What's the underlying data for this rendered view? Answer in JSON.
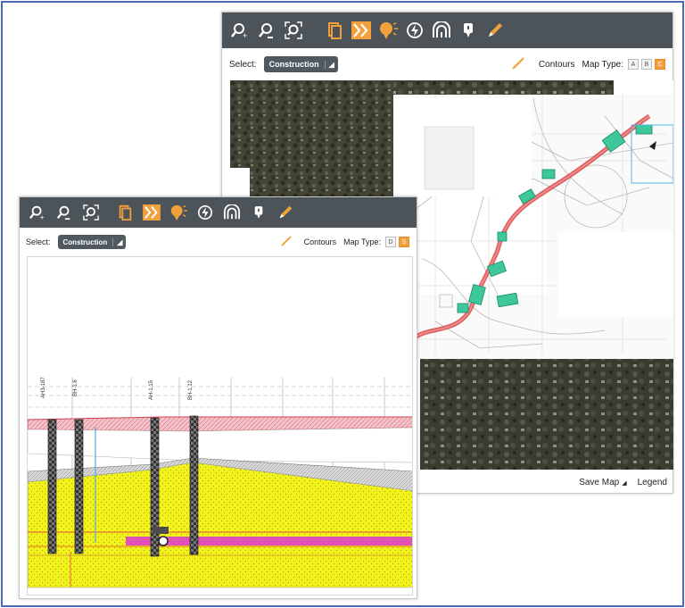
{
  "back_window": {
    "toolbar_icons": [
      "zoom-in-icon",
      "zoom-out-icon",
      "zoom-extent-icon",
      "layers-icon",
      "chevron-forward-icon",
      "lightbulb-icon",
      "lightning-icon",
      "tunnel-icon",
      "marker-icon",
      "pencil-icon"
    ],
    "select_label": "Select:",
    "select_value": "Construction",
    "contours_label": "Contours",
    "map_type_label": "Map Type:",
    "map_types": [
      "A",
      "B",
      "C"
    ],
    "map_type_selected": "C",
    "save_map_label": "Save Map",
    "legend_label": "Legend"
  },
  "front_window": {
    "toolbar_icons": [
      "zoom-in-icon",
      "zoom-out-icon",
      "zoom-extent-icon",
      "layers-icon",
      "chevron-forward-icon",
      "lightbulb-icon",
      "lightning-icon",
      "tunnel-icon",
      "marker-icon",
      "pencil-icon"
    ],
    "select_label": "Select:",
    "select_value": "Construction",
    "contours_label": "Contours",
    "map_type_label": "Map Type:",
    "map_types": [
      "D",
      "S"
    ],
    "map_type_selected": "S",
    "boreholes": [
      "AH3-187",
      "BH-1.6",
      "AH-1.15",
      "BH-1.12"
    ]
  },
  "colors": {
    "toolbar_bg": "#4d5459",
    "accent_orange": "#f2a03c",
    "clay_pink": "#f2b8c0",
    "sand_yellow": "#f2f21c",
    "magenta_layer": "#e040c8",
    "frame_blue": "#4a6bb4"
  }
}
